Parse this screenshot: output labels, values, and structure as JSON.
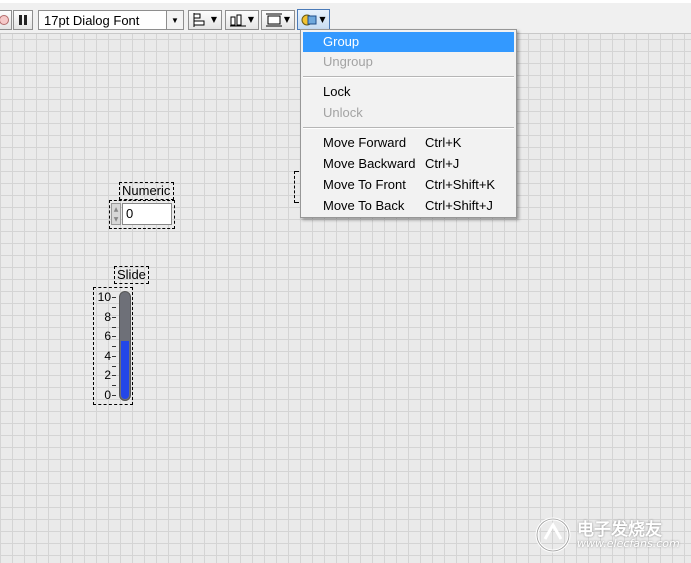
{
  "toolbar": {
    "font_ring_value": "17pt Dialog Font",
    "icons": [
      "abort-icon",
      "pause-icon",
      "align-objects-icon",
      "distribute-objects-icon",
      "resize-objects-icon",
      "reorder-icon"
    ]
  },
  "menu": {
    "items": [
      {
        "label": "Group",
        "shortcut": "",
        "state": "highlighted"
      },
      {
        "label": "Ungroup",
        "shortcut": "",
        "state": "disabled"
      },
      {
        "label": "Lock",
        "shortcut": "",
        "state": "enabled"
      },
      {
        "label": "Unlock",
        "shortcut": "",
        "state": "disabled"
      },
      {
        "label": "Move Forward",
        "shortcut": "Ctrl+K",
        "state": "enabled"
      },
      {
        "label": "Move Backward",
        "shortcut": "Ctrl+J",
        "state": "enabled"
      },
      {
        "label": "Move To Front",
        "shortcut": "Ctrl+Shift+K",
        "state": "enabled"
      },
      {
        "label": "Move To Back",
        "shortcut": "Ctrl+Shift+J",
        "state": "enabled"
      }
    ]
  },
  "numeric": {
    "label": "Numeric",
    "value": "0"
  },
  "slide": {
    "label": "Slide",
    "scale": [
      "10",
      "8",
      "6",
      "4",
      "2",
      "0"
    ],
    "level": 5.5,
    "range": [
      0,
      10
    ],
    "colors": {
      "track": "#6e7078",
      "fill": "#2346e8"
    }
  },
  "colors": {
    "highlight": "#3399ff",
    "disabled_text": "#a3a3a3",
    "grid_background": "#eaeaea"
  },
  "watermark": {
    "title": "电子发烧友",
    "url": "www.elecfans.com"
  }
}
